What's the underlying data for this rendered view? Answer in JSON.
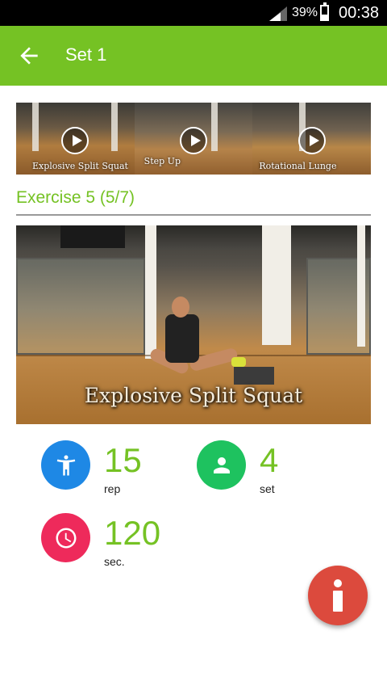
{
  "status_bar": {
    "battery_percent": "39%",
    "battery_level": 0.39,
    "time": "00:38",
    "icons": [
      "signal-icon",
      "battery-icon"
    ]
  },
  "toolbar": {
    "back_icon": "arrow-left-icon",
    "title": "Set 1"
  },
  "thumbnails": [
    {
      "label": "Explosive Split Squat"
    },
    {
      "label": "Step Up"
    },
    {
      "label": "Rotational Lunge"
    }
  ],
  "exercise": {
    "title": "Exercise 5 (5/7)",
    "video_caption": "Explosive Split Squat"
  },
  "stats": {
    "reps": {
      "value": "15",
      "unit": "rep",
      "icon": "person-icon",
      "color": "#1e88e5"
    },
    "sets": {
      "value": "4",
      "unit": "set",
      "icon": "account-icon",
      "color": "#1ec25f"
    },
    "rest": {
      "value": "120",
      "unit": "sec.",
      "icon": "clock-icon",
      "color": "#ee2a5b"
    }
  },
  "fab": {
    "icon": "info-icon",
    "color": "#dc4a3d"
  },
  "colors": {
    "accent": "#75c224",
    "status_bar": "#000000"
  }
}
